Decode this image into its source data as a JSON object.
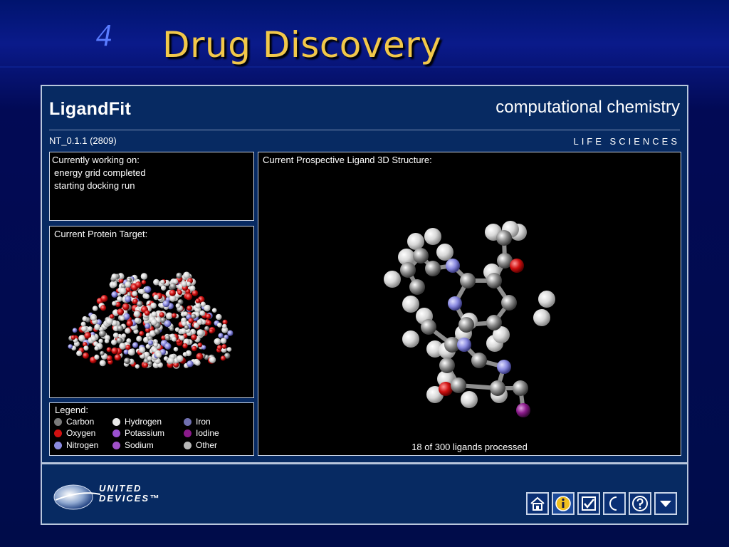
{
  "slide": {
    "number": "4",
    "title": "Drug Discovery"
  },
  "app": {
    "brand": "LigandFit",
    "tagline": "computational chemistry",
    "version": "NT_0.1.1 (2809)",
    "division": "LIFE SCIENCES",
    "status": {
      "heading": "Currently working on:",
      "lines": [
        "energy grid completed",
        "starting docking run"
      ]
    },
    "protein": {
      "heading": "Current Protein Target:"
    },
    "ligand": {
      "heading": "Current Prospective Ligand 3D Structure:",
      "progress": "18 of 300 ligands processed"
    },
    "legend": {
      "heading": "Legend:",
      "items": [
        {
          "label": "Carbon",
          "color": "#7a7a7a"
        },
        {
          "label": "Oxygen",
          "color": "#d01010"
        },
        {
          "label": "Nitrogen",
          "color": "#8a8ae0"
        },
        {
          "label": "Hydrogen",
          "color": "#e8e8e8"
        },
        {
          "label": "Potassium",
          "color": "#9a50d0"
        },
        {
          "label": "Sodium",
          "color": "#a050c8"
        },
        {
          "label": "Iron",
          "color": "#7070b0"
        },
        {
          "label": "Iodine",
          "color": "#8a1a8a"
        },
        {
          "label": "Other",
          "color": "#b8b8b8"
        }
      ]
    },
    "logo": {
      "line1": "UNITED",
      "line2": "DEVICES™"
    },
    "toolbar": [
      "home-icon",
      "info-icon",
      "checkbox-icon",
      "moon-icon",
      "help-icon",
      "dropdown-icon"
    ]
  }
}
